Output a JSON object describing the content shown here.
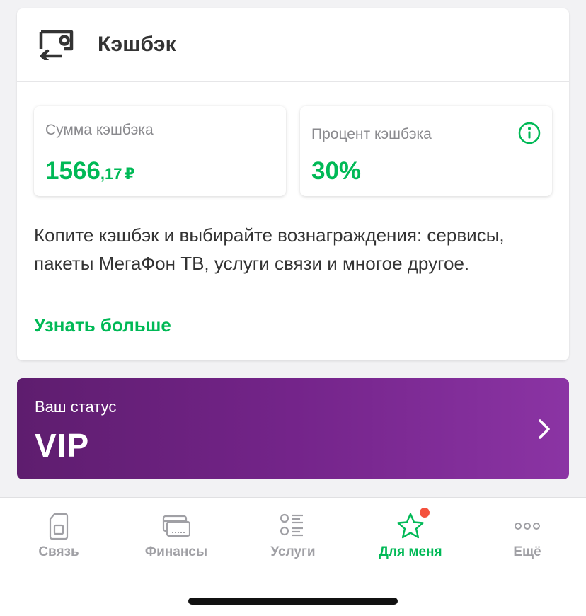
{
  "cashback": {
    "title": "Кэшбэк",
    "sum": {
      "label": "Сумма кэшбэка",
      "value_int": "1566",
      "value_dec": ",17",
      "currency": "₽"
    },
    "percent": {
      "label": "Процент кэшбэка",
      "value": "30%"
    },
    "description": "Копите кэшбэк и выбирайте вознаграждения: сервисы, пакеты МегаФон ТВ, услуги связи и многое другое.",
    "learn_more": "Узнать больше"
  },
  "status": {
    "label": "Ваш статус",
    "value": "VIP"
  },
  "nav": {
    "items": [
      {
        "label": "Связь",
        "icon": "sim-card-icon"
      },
      {
        "label": "Финансы",
        "icon": "cards-icon"
      },
      {
        "label": "Услуги",
        "icon": "list-icon"
      },
      {
        "label": "Для меня",
        "icon": "star-icon"
      },
      {
        "label": "Ещё",
        "icon": "more-dots-icon"
      }
    ],
    "active_index": 3
  },
  "colors": {
    "accent_green": "#00b956",
    "banner_purple": "#731f87",
    "badge_red": "#f4513d",
    "nav_inactive": "#a0a0a5"
  }
}
